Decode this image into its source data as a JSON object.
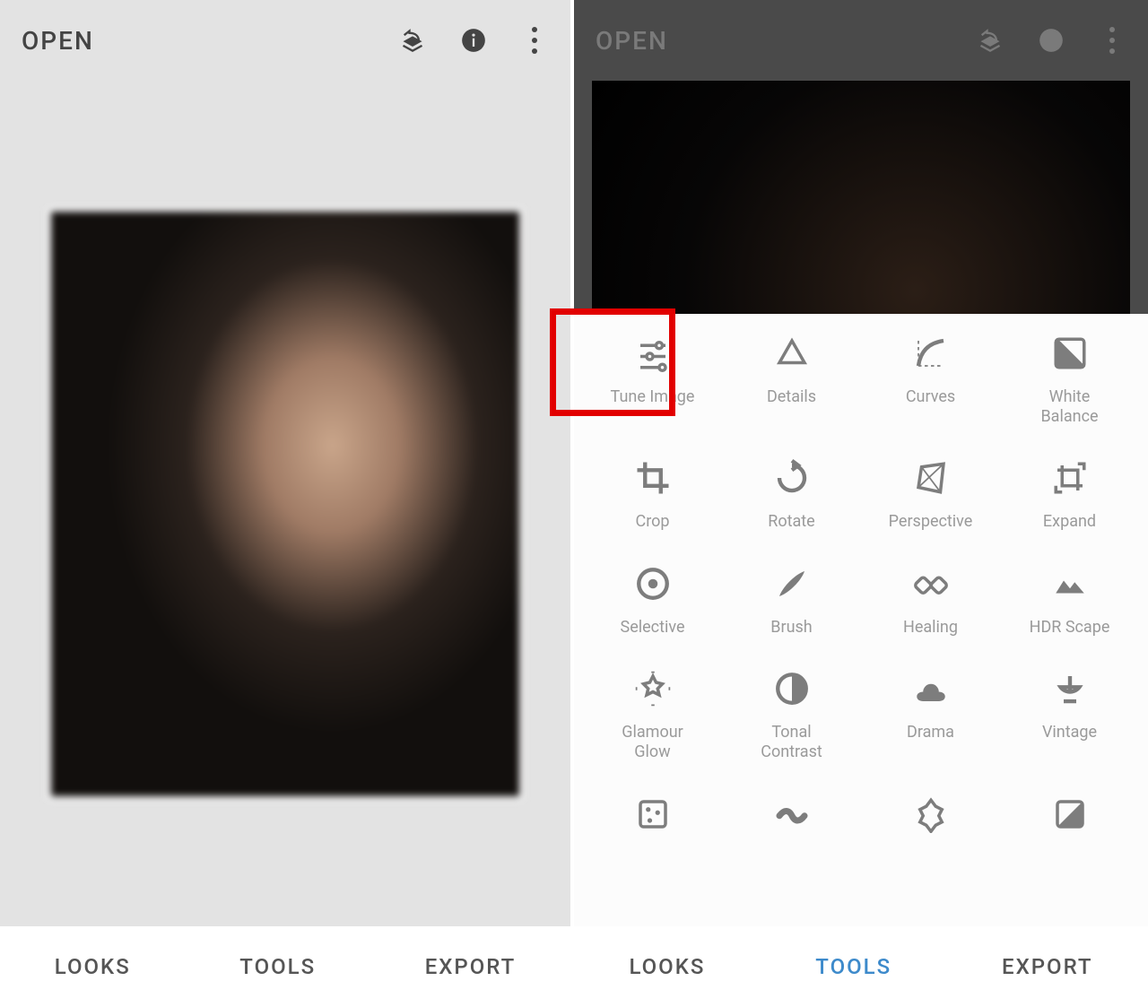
{
  "left": {
    "open_label": "OPEN",
    "nav": {
      "looks": "LOOKS",
      "tools": "TOOLS",
      "export": "EXPORT"
    }
  },
  "right": {
    "open_label": "OPEN",
    "nav": {
      "looks": "LOOKS",
      "tools": "TOOLS",
      "export": "EXPORT"
    },
    "tools": [
      {
        "id": "tune-image",
        "label": "Tune Image"
      },
      {
        "id": "details",
        "label": "Details"
      },
      {
        "id": "curves",
        "label": "Curves"
      },
      {
        "id": "white-balance",
        "label": "White\nBalance"
      },
      {
        "id": "crop",
        "label": "Crop"
      },
      {
        "id": "rotate",
        "label": "Rotate"
      },
      {
        "id": "perspective",
        "label": "Perspective"
      },
      {
        "id": "expand",
        "label": "Expand"
      },
      {
        "id": "selective",
        "label": "Selective"
      },
      {
        "id": "brush",
        "label": "Brush"
      },
      {
        "id": "healing",
        "label": "Healing"
      },
      {
        "id": "hdr-scape",
        "label": "HDR Scape"
      },
      {
        "id": "glamour-glow",
        "label": "Glamour\nGlow"
      },
      {
        "id": "tonal-contrast",
        "label": "Tonal\nContrast"
      },
      {
        "id": "drama",
        "label": "Drama"
      },
      {
        "id": "vintage",
        "label": "Vintage"
      },
      {
        "id": "grainy-film",
        "label": ""
      },
      {
        "id": "retrolux",
        "label": ""
      },
      {
        "id": "grunge",
        "label": ""
      },
      {
        "id": "bw",
        "label": ""
      }
    ],
    "highlighted_tool": "tune-image"
  }
}
